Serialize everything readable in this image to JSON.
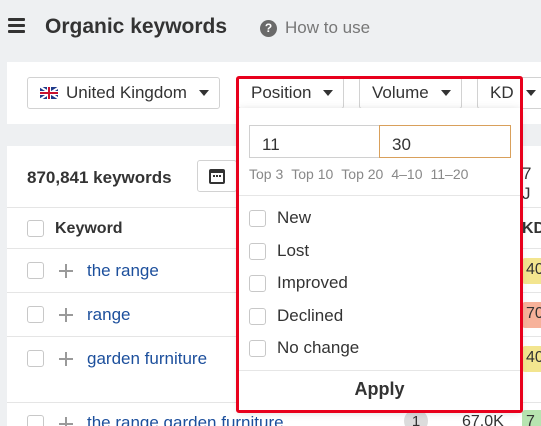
{
  "header": {
    "title": "Organic keywords",
    "help_label": "How to use",
    "help_icon": "question-circle-icon"
  },
  "filters": {
    "country": "United Kingdom",
    "position": "Position",
    "volume": "Volume",
    "kd": "KD"
  },
  "toolbar": {
    "keyword_count": "870,841 keywords",
    "right_fragment": "7 J"
  },
  "table": {
    "col_keyword": "Keyword",
    "col_kd": "KD",
    "rows": [
      {
        "keyword": "the range",
        "kd": "40",
        "kd_color": "#f3e58f"
      },
      {
        "keyword": "range",
        "kd": "70",
        "kd_color": "#f7b29a"
      },
      {
        "keyword": "garden furniture",
        "kd": "40",
        "kd_color": "#f3e58f"
      },
      {
        "keyword": "the range garden furniture",
        "position": "1",
        "volume": "67.0K",
        "kd": "7",
        "kd_color": "#b7e4b0"
      }
    ]
  },
  "position_dropdown": {
    "from_value": "11",
    "to_value": "30",
    "presets": [
      "Top 3",
      "Top 10",
      "Top 20",
      "4–10",
      "11–20"
    ],
    "options": [
      "New",
      "Lost",
      "Improved",
      "Declined",
      "No change"
    ],
    "apply_label": "Apply"
  },
  "colors": {
    "highlight_border": "#e8001c",
    "link": "#1c4f9c",
    "focused_input_border": "#d9a05b"
  }
}
